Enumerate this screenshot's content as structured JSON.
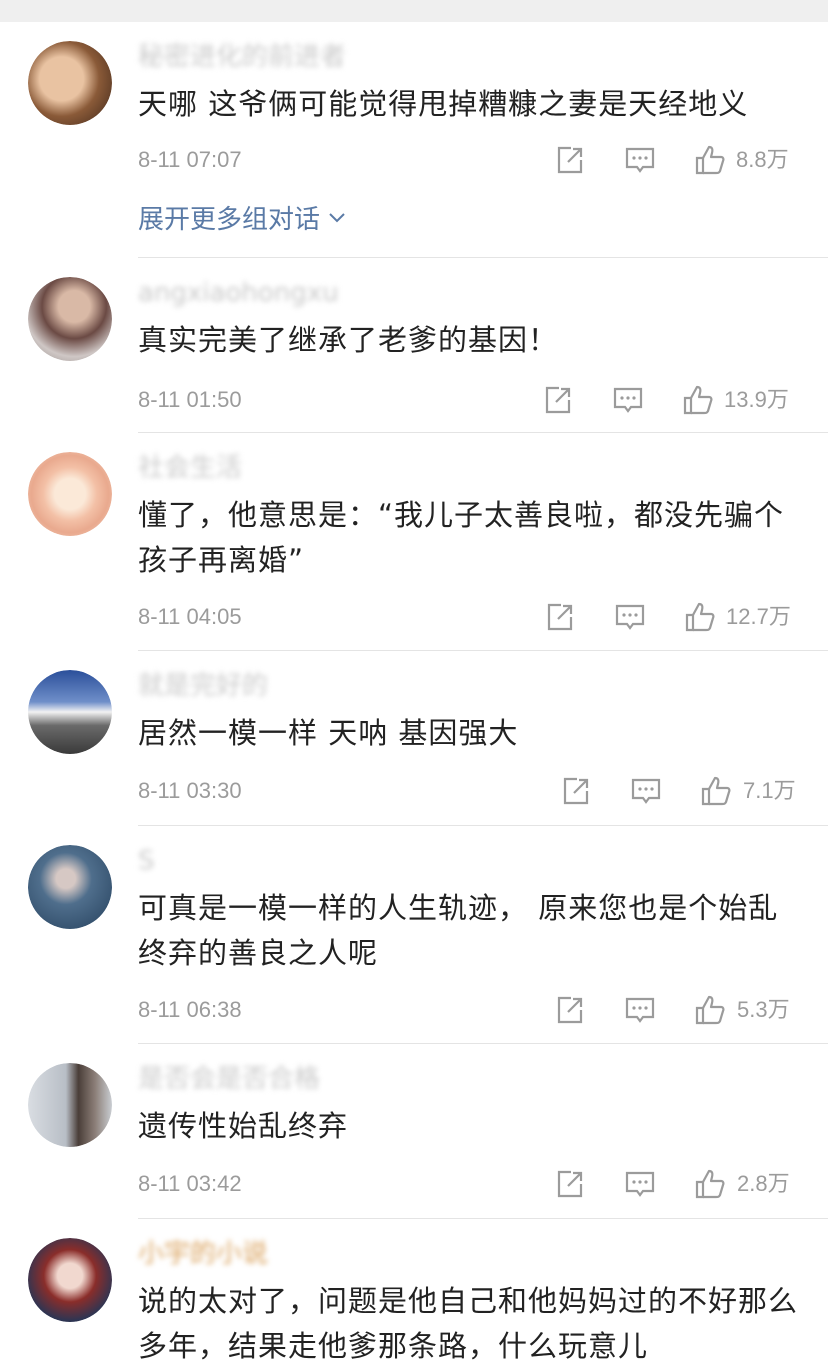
{
  "comments": [
    {
      "username": "秘密进化的前进者",
      "text": "天哪 这爷俩可能觉得甩掉糟糠之妻是天经地义",
      "time": "8-11 07:07",
      "likes": "8.8万",
      "expand": "展开更多组对话"
    },
    {
      "username": "angxiaohongxu",
      "text": "真实完美了继承了老爹的基因！",
      "time": "8-11 01:50",
      "likes": "13.9万"
    },
    {
      "username": "社会生活",
      "text": "懂了，他意思是：“我儿子太善良啦，都没先骗个孩子再离婚”",
      "time": "8-11 04:05",
      "likes": "12.7万"
    },
    {
      "username": "就是完好的",
      "text": "居然一模一样 天呐 基因强大",
      "time": "8-11 03:30",
      "likes": "7.1万"
    },
    {
      "username": "S",
      "text": "可真是一模一样的人生轨迹， 原来您也是个始乱终弃的善良之人呢",
      "time": "8-11 06:38",
      "likes": "5.3万"
    },
    {
      "username": "是否会是否合格",
      "text": "遗传性始乱终弃",
      "time": "8-11 03:42",
      "likes": "2.8万"
    },
    {
      "username": "小宇的小说",
      "text": "说的太对了，问题是他自己和他妈妈过的不好那么多年，结果走他爹那条路，什么玩意儿",
      "time": "",
      "likes": ""
    }
  ],
  "icons": {
    "share": "share-icon",
    "comment": "comment-icon",
    "like": "like-icon"
  },
  "colors": {
    "text": "#222222",
    "meta": "#9b9b9b",
    "link": "#5a7aa6",
    "divider": "#e4e4e4"
  }
}
